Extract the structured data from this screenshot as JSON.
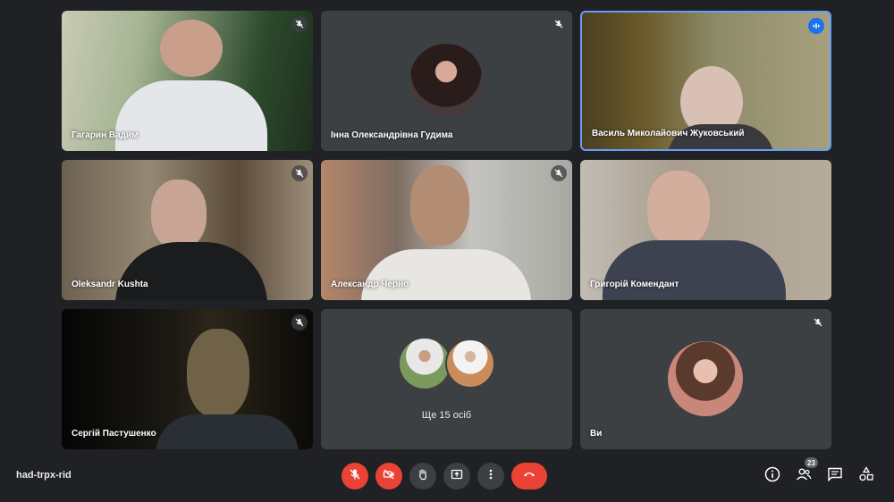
{
  "participants": [
    {
      "name": "Гагарин Вадим",
      "muted": true
    },
    {
      "name": "Інна Олександрівна Гудима",
      "muted": true
    },
    {
      "name": "Василь Миколайович Жуковський",
      "muted": false,
      "speaking": true
    },
    {
      "name": "Oleksandr Kushta",
      "muted": true
    },
    {
      "name": "Александр Черно",
      "muted": true
    },
    {
      "name": "Григорій Комендант",
      "muted": false
    },
    {
      "name": "Сергій Пастушенко",
      "muted": true
    },
    {
      "name": "Ви",
      "muted": true
    }
  ],
  "others_tile": {
    "label": "Ще 15 осіб"
  },
  "meeting_code": "had-trpx-rid",
  "controls": [
    "mic-off",
    "camera-off",
    "raise-hand",
    "present-screen",
    "more-options",
    "end-call"
  ],
  "right_panel": {
    "participant_count": "23",
    "icons": [
      "info-icon",
      "people-icon",
      "chat-icon",
      "activities-icon"
    ]
  },
  "colors": {
    "background": "#202124",
    "tile": "#3c4043",
    "danger": "#ea4335",
    "accent": "#1a73e8",
    "speaking_border": "#669df6"
  }
}
